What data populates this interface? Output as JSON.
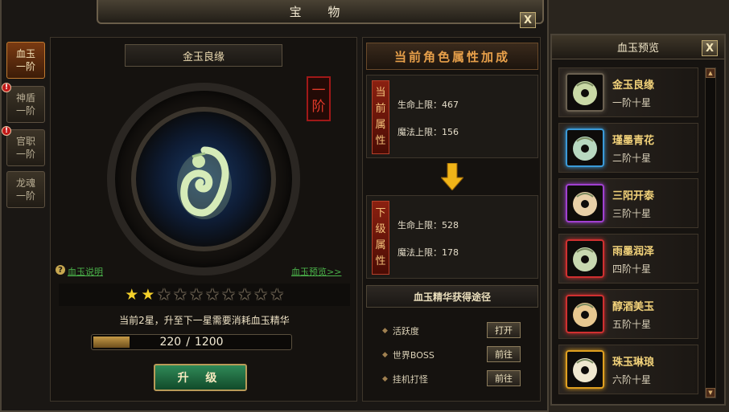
{
  "main_window": {
    "title": "宝 物",
    "close_label": "X"
  },
  "side_tabs": [
    {
      "line1": "血玉",
      "line2": "一阶",
      "active": true,
      "alert": false
    },
    {
      "line1": "神盾",
      "line2": "一阶",
      "active": false,
      "alert": true
    },
    {
      "line1": "官职",
      "line2": "一阶",
      "active": false,
      "alert": true
    },
    {
      "line1": "龙魂",
      "line2": "一阶",
      "active": false,
      "alert": false
    }
  ],
  "alert_mark": "!",
  "item": {
    "name": "金玉良缘",
    "level_badge_1": "一",
    "level_badge_2": "阶",
    "help_icon": "?",
    "help_link": "血玉说明",
    "preview_link": "血玉预览>>",
    "stars_filled": 2,
    "stars_total": 10,
    "star_glyph": "★",
    "cost_text": "当前2星，升至下一星需要消耗血玉精华",
    "progress_current": "220",
    "progress_sep": "/",
    "progress_max": "1200",
    "progress_fraction": 0.183,
    "upgrade_label": "升 级"
  },
  "attributes": {
    "header": "当前角色属性加成",
    "current_label": [
      "当",
      "前",
      "属",
      "性"
    ],
    "current": [
      {
        "text": "生命上限：467"
      },
      {
        "text": "魔法上限：156"
      }
    ],
    "next_label": [
      "下",
      "级",
      "属",
      "性"
    ],
    "next": [
      {
        "text": "生命上限：528"
      },
      {
        "text": "魔法上限：178"
      }
    ]
  },
  "obtain": {
    "header": "血玉精华获得途径",
    "bullet": "◆",
    "rows": [
      {
        "label": "活跃度",
        "button": "打开"
      },
      {
        "label": "世界BOSS",
        "button": "前往"
      },
      {
        "label": "挂机打怪",
        "button": "前往"
      }
    ]
  },
  "preview_window": {
    "title": "血玉预览",
    "close_label": "X",
    "scroll_up": "▲",
    "scroll_down": "▼",
    "items": [
      {
        "name": "金玉良缘",
        "tier": "一阶十星",
        "frame_color": "#6a6050",
        "jade_color": "#c9d9a6"
      },
      {
        "name": "瑾墨青花",
        "tier": "二阶十星",
        "frame_color": "#3a9ad8",
        "jade_color": "#b8d8c0"
      },
      {
        "name": "三阳开泰",
        "tier": "三阶十星",
        "frame_color": "#a040d0",
        "jade_color": "#e8d0a8"
      },
      {
        "name": "雨墨润泽",
        "tier": "四阶十星",
        "frame_color": "#d03030",
        "jade_color": "#c8d8b0"
      },
      {
        "name": "醇酒美玉",
        "tier": "五阶十星",
        "frame_color": "#d03030",
        "jade_color": "#e8c890"
      },
      {
        "name": "珠玉琳琅",
        "tier": "六阶十星",
        "frame_color": "#e0a020",
        "jade_color": "#f0e8d0"
      }
    ]
  }
}
